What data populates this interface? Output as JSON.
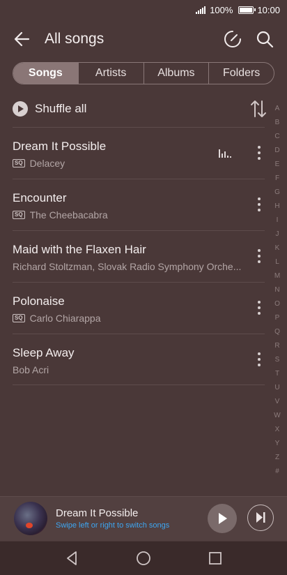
{
  "status_bar": {
    "battery": "100%",
    "time": "10:00"
  },
  "header": {
    "title": "All songs"
  },
  "tabs": [
    {
      "label": "Songs",
      "active": true
    },
    {
      "label": "Artists",
      "active": false
    },
    {
      "label": "Albums",
      "active": false
    },
    {
      "label": "Folders",
      "active": false
    }
  ],
  "shuffle": {
    "label": "Shuffle all"
  },
  "songs": [
    {
      "title": "Dream It Possible",
      "artist": "Delacey",
      "sq": true,
      "playing": true
    },
    {
      "title": "Encounter",
      "artist": "The Cheebacabra",
      "sq": true,
      "playing": false
    },
    {
      "title": "Maid with the Flaxen Hair",
      "artist": "Richard Stoltzman, Slovak Radio Symphony Orche...",
      "sq": false,
      "playing": false
    },
    {
      "title": "Polonaise",
      "artist": "Carlo Chiarappa",
      "sq": true,
      "playing": false
    },
    {
      "title": "Sleep Away",
      "artist": "Bob Acri",
      "sq": false,
      "playing": false
    }
  ],
  "sq_label": "SQ",
  "alphabet_index": [
    "A",
    "B",
    "C",
    "D",
    "E",
    "F",
    "G",
    "H",
    "I",
    "J",
    "K",
    "L",
    "M",
    "N",
    "O",
    "P",
    "Q",
    "R",
    "S",
    "T",
    "U",
    "V",
    "W",
    "X",
    "Y",
    "Z",
    "#"
  ],
  "now_playing": {
    "title": "Dream It Possible",
    "hint": "Swipe left or right to switch songs"
  },
  "colors": {
    "background": "#4a3838",
    "accent_link": "#3da6f2"
  }
}
